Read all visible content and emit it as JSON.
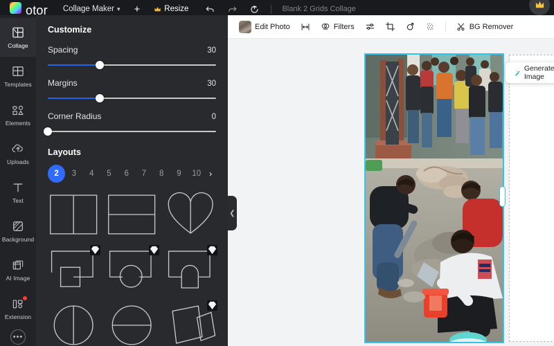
{
  "app": {
    "brand": "otor",
    "brand_full": "Fotor",
    "doc_type": "Collage Maker",
    "doc_type_caret": "∨",
    "add_label": "+",
    "resize_label": "Resize",
    "doc_title": "Blank 2 Grids Collage"
  },
  "topbar_icons": [
    {
      "name": "undo-icon",
      "label": "Undo"
    },
    {
      "name": "redo-icon",
      "label": "Redo"
    },
    {
      "name": "reset-icon",
      "label": "Reset"
    }
  ],
  "sidebar": {
    "items": [
      {
        "label": "Collage",
        "icon": "collage-icon",
        "active": true,
        "badge": false
      },
      {
        "label": "Templates",
        "icon": "templates-icon",
        "active": false,
        "badge": false
      },
      {
        "label": "Elements",
        "icon": "elements-icon",
        "active": false,
        "badge": false
      },
      {
        "label": "Uploads",
        "icon": "uploads-icon",
        "active": false,
        "badge": false
      },
      {
        "label": "Text",
        "icon": "text-icon",
        "active": false,
        "badge": false
      },
      {
        "label": "Background",
        "icon": "background-icon",
        "active": false,
        "badge": false
      },
      {
        "label": "AI Image",
        "icon": "ai-image-icon",
        "active": false,
        "badge": false
      },
      {
        "label": "Extension",
        "icon": "extension-icon",
        "active": false,
        "badge": true
      }
    ],
    "more_label": "•••"
  },
  "panel": {
    "title": "Customize",
    "controls": [
      {
        "label": "Spacing",
        "value": "30",
        "percent": 31
      },
      {
        "label": "Margins",
        "value": "30",
        "percent": 31
      },
      {
        "label": "Corner Radius",
        "value": "0",
        "percent": 0
      }
    ],
    "layouts_title": "Layouts",
    "counts": [
      "2",
      "3",
      "4",
      "5",
      "6",
      "7",
      "8",
      "9",
      "10"
    ],
    "selected_count": "2",
    "next_arrow": "›",
    "thumbs": [
      {
        "name": "layout-two-columns",
        "shape": "two-col",
        "premium": false
      },
      {
        "name": "layout-two-rows",
        "shape": "two-row",
        "premium": false
      },
      {
        "name": "layout-heart-split",
        "shape": "heart",
        "premium": false
      },
      {
        "name": "layout-square-overlay",
        "shape": "sq-overlay",
        "premium": true
      },
      {
        "name": "layout-circle-overlay",
        "shape": "circle-ov",
        "premium": true
      },
      {
        "name": "layout-arch-overlay",
        "shape": "arch-ov",
        "premium": true
      },
      {
        "name": "layout-circle-vertical",
        "shape": "circ-vert",
        "premium": false
      },
      {
        "name": "layout-circle-horizontal",
        "shape": "circ-horiz",
        "premium": false
      },
      {
        "name": "layout-tilted-cards",
        "shape": "tilted",
        "premium": true
      }
    ]
  },
  "collapse": {
    "icon": "chevron-left-icon"
  },
  "canvas_toolbar": {
    "edit_photo": "Edit Photo",
    "filters": "Filters",
    "bg_remover": "BG Remover",
    "icons": [
      {
        "name": "flip-horizontal-icon"
      },
      {
        "name": "adjust-icon"
      },
      {
        "name": "crop-icon"
      },
      {
        "name": "rotate-icon"
      },
      {
        "name": "texture-icon"
      },
      {
        "name": "scissors-icon"
      }
    ]
  },
  "float_toolbar": {
    "generate_image": "Generate Image",
    "icons": [
      {
        "name": "magic-wand-icon"
      },
      {
        "name": "replace-image-icon"
      },
      {
        "name": "crop-icon"
      },
      {
        "name": "more-icon"
      }
    ],
    "more_label": "•••"
  },
  "colors": {
    "accent_blue": "#2563eb",
    "chip_blue": "#2f6bff",
    "selection_cyan": "#35c4e8",
    "badge_red": "#ff3b30",
    "panel_bg": "#292a2e",
    "rail_bg": "#222327",
    "topbar_bg": "#191a1d",
    "stage_bg": "#f1f3f5"
  }
}
